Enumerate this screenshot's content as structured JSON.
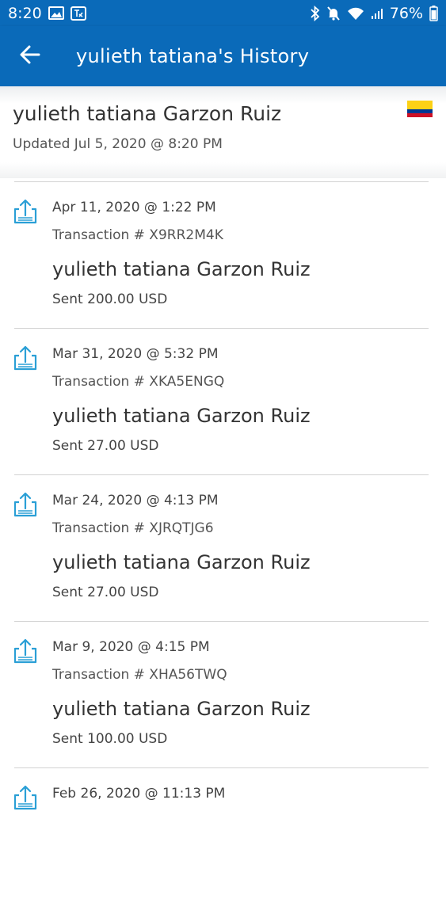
{
  "status_bar": {
    "time": "8:20",
    "battery": "76%"
  },
  "app_bar": {
    "title": "yulieth tatiana's History"
  },
  "profile": {
    "name": "yulieth tatiana Garzon Ruiz",
    "updated": "Updated Jul 5, 2020 @ 8:20 PM",
    "flag_colors": [
      "#fcd116",
      "#003893",
      "#ce1126"
    ]
  },
  "transactions": [
    {
      "date": "Apr 11, 2020 @ 1:22 PM",
      "id": "Transaction # X9RR2M4K",
      "name": "yulieth tatiana Garzon Ruiz",
      "amount": "Sent 200.00 USD"
    },
    {
      "date": "Mar 31, 2020 @ 5:32 PM",
      "id": "Transaction # XKA5ENGQ",
      "name": "yulieth tatiana Garzon Ruiz",
      "amount": "Sent 27.00 USD"
    },
    {
      "date": "Mar 24, 2020 @ 4:13 PM",
      "id": "Transaction # XJRQTJG6",
      "name": "yulieth tatiana Garzon Ruiz",
      "amount": "Sent 27.00 USD"
    },
    {
      "date": "Mar 9, 2020 @ 4:15 PM",
      "id": "Transaction # XHA56TWQ",
      "name": "yulieth tatiana Garzon Ruiz",
      "amount": "Sent 100.00 USD"
    },
    {
      "date": "Feb 26, 2020 @ 11:13 PM",
      "id": "",
      "name": "",
      "amount": ""
    }
  ],
  "colors": {
    "brand_blue": "#0a6ab9",
    "icon_blue": "#2a9fd6"
  },
  "icons": {
    "back": "arrow-left-icon",
    "transaction": "send-money-icon"
  }
}
